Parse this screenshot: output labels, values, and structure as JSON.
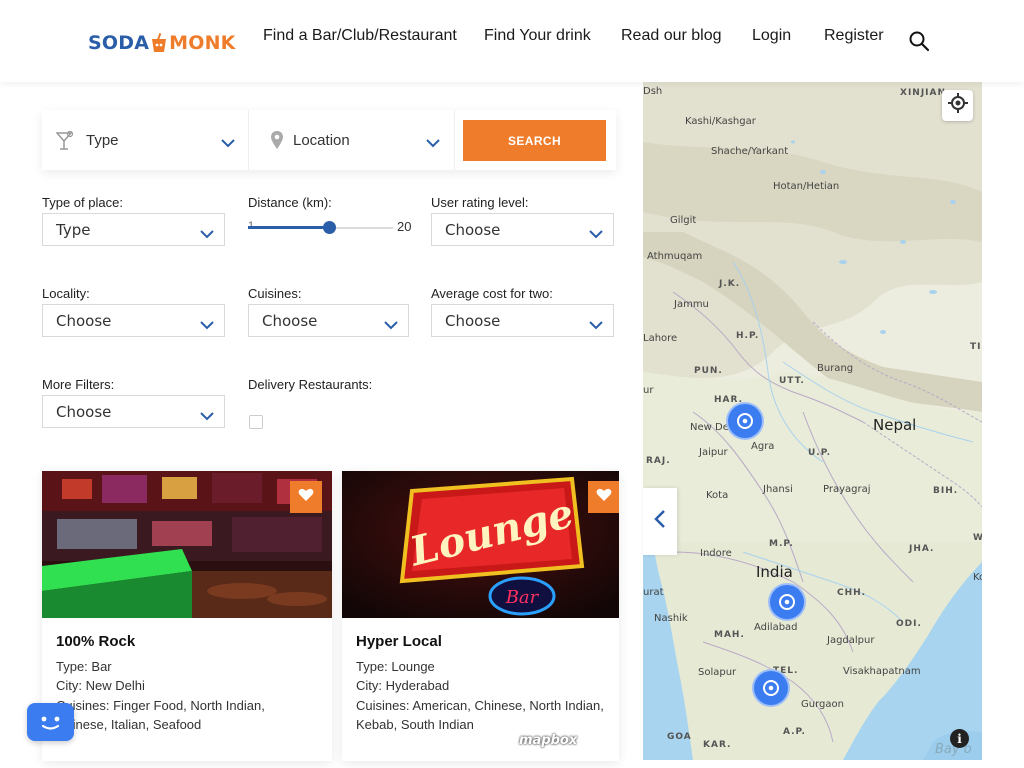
{
  "header": {
    "logo": {
      "left": "SODA",
      "right": "MONK"
    },
    "nav": [
      {
        "label": "Find a Bar/Club/Restaurant"
      },
      {
        "label": "Find Your drink"
      },
      {
        "label": "Read our blog"
      },
      {
        "label": "Login"
      },
      {
        "label": "Register"
      }
    ],
    "search_icon": "search-icon"
  },
  "searchbar": {
    "type_label": "Type",
    "location_label": "Location",
    "button_label": "SEARCH"
  },
  "filters": {
    "type_of_place": {
      "label": "Type of place:",
      "value": "Type"
    },
    "distance": {
      "label": "Distance (km):",
      "min": "1",
      "max": "20",
      "value_fraction": 0.56
    },
    "user_rating": {
      "label": "User rating level:",
      "value": "Choose"
    },
    "locality": {
      "label": "Locality:",
      "value": "Choose"
    },
    "cuisines": {
      "label": "Cuisines:",
      "value": "Choose"
    },
    "avg_cost": {
      "label": "Average cost for two:",
      "value": "Choose"
    },
    "more_filters": {
      "label": "More Filters:",
      "value": "Choose"
    },
    "delivery": {
      "label": "Delivery Restaurants:",
      "checked": false
    }
  },
  "cards": [
    {
      "title": "100% Rock",
      "type": "Type: Bar",
      "city": "City: New Delhi",
      "cuisines_line1": "Cuisines: Finger Food, North Indian,",
      "cuisines_line2": "Chinese, Italian, Seafood"
    },
    {
      "title": "Hyper Local",
      "type": "Type: Lounge",
      "city": "City: Hyderabad",
      "cuisines_line1": "Cuisines: American, Chinese, North Indian,",
      "cuisines_line2": "Kebab, South Indian",
      "sign_text": "Lounge",
      "sign_sub": "Bar"
    }
  ],
  "map": {
    "labels": {
      "xinjiang": "XINJIAN",
      "dsh": "Dsh",
      "kashi": "Kashi/Kashgar",
      "shache": "Shache/Yarkant",
      "hotan": "Hotan/Hetian",
      "gilgit": "Gilgit",
      "athmuqam": "Athmuqam",
      "jk": "J.K.",
      "jammu": "Jammu",
      "hp": "H.P.",
      "lahore": "Lahore",
      "ti": "TI",
      "pun": "PUN.",
      "utt": "UTT.",
      "burang": "Burang",
      "ur": "ur",
      "har": "HAR.",
      "nepal": "Nepal",
      "newdelhi": "New Delhi",
      "agra": "Agra",
      "jaipur": "Jaipur",
      "up": "U.P.",
      "raj": "RAJ.",
      "kota": "Kota",
      "jhansi": "Jhansi",
      "prayagraj": "Prayagraj",
      "bih": "BIH.",
      "mp": "M.P.",
      "w": "W",
      "indore": "Indore",
      "jha": "JHA.",
      "india": "India",
      "ko": "Ko",
      "urat": "urat",
      "chh": "CHH.",
      "nashik": "Nashik",
      "adilabad": "Adilabad",
      "odi": "ODI.",
      "mah": "MAH.",
      "jagdalpur": "Jagdalpur",
      "solapur": "Solapur",
      "tel": "TEL.",
      "visakhapatnam": "Visakhapatnam",
      "gurgaon": "Gurgaon",
      "goa": "GOA",
      "kar": "KAR.",
      "ap": "A.P.",
      "bay": "Bay o"
    },
    "mapbox": "mapbox",
    "info": "i"
  }
}
